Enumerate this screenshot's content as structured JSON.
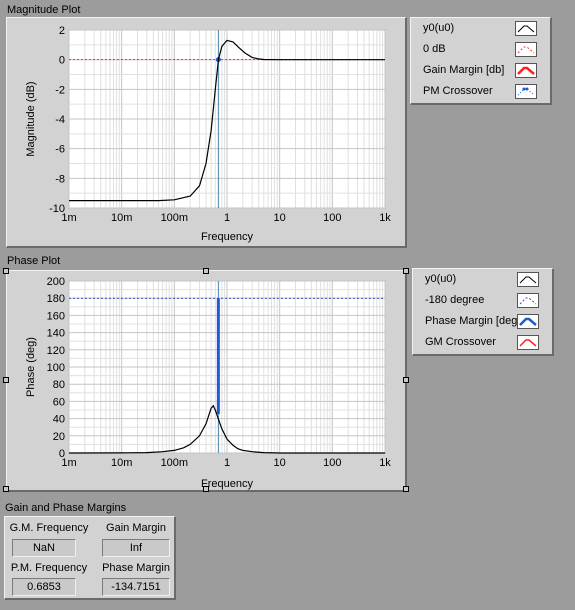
{
  "magnitude": {
    "caption": "Magnitude Plot",
    "ylabel": "Magnitude (dB)",
    "xlabel": "Frequency",
    "legend": [
      "y0(u0)",
      "0 dB",
      "Gain Margin [db]",
      "PM Crossover"
    ],
    "colors": {
      "trace": "#000000",
      "zero_line": "#ff3030",
      "marker": "#1e5ad6",
      "grid": "#c4c4c4",
      "grid_minor": "#e0e0e0"
    }
  },
  "phase": {
    "caption": "Phase Plot",
    "ylabel": "Phase (deg)",
    "xlabel": "Frequency",
    "legend": [
      "y0(u0)",
      "-180 degree",
      "Phase Margin [deg]",
      "GM Crossover"
    ],
    "colors": {
      "trace": "#000000",
      "ref_line": "#3050d0",
      "margin_bar": "#1e5ad6",
      "grid": "#c4c4c4",
      "grid_minor": "#e0e0e0"
    }
  },
  "margins": {
    "title": "Gain and Phase Margins",
    "gm_frequency_label": "G.M. Frequency",
    "gm_frequency_value": "NaN",
    "gain_margin_label": "Gain Margin",
    "gain_margin_value": "Inf",
    "pm_frequency_label": "P.M. Frequency",
    "pm_frequency_value": "0.6853",
    "phase_margin_label": "Phase Margin",
    "phase_margin_value": "-134.7151"
  },
  "chart_data": [
    {
      "type": "line",
      "title": "Magnitude Plot",
      "xlabel": "Frequency",
      "ylabel": "Magnitude (dB)",
      "xscale": "log",
      "xlim": [
        0.001,
        1000
      ],
      "ylim": [
        -10,
        2
      ],
      "xticks": [
        "1m",
        "10m",
        "100m",
        "1",
        "10",
        "100",
        "1k"
      ],
      "yticks": [
        "-10",
        "-8",
        "-6",
        "-4",
        "-2",
        "0",
        "2"
      ],
      "grid": true,
      "legend_position": "right",
      "series": [
        {
          "name": "y0(u0)",
          "x": [
            0.001,
            0.01,
            0.05,
            0.1,
            0.2,
            0.3,
            0.4,
            0.5,
            0.6,
            0.6853,
            0.8,
            1.0,
            1.3,
            1.7,
            2.2,
            3.0,
            4.0,
            5.0,
            10,
            100,
            1000
          ],
          "y": [
            -9.5,
            -9.5,
            -9.5,
            -9.45,
            -9.2,
            -8.5,
            -7.0,
            -4.8,
            -2.0,
            0,
            0.9,
            1.3,
            1.2,
            0.8,
            0.45,
            0.15,
            0.05,
            0.01,
            0,
            0,
            0
          ]
        },
        {
          "name": "0 dB",
          "x": [
            0.001,
            1000
          ],
          "y": [
            0,
            0
          ]
        },
        {
          "name": "PM Crossover",
          "x": [
            0.6853
          ],
          "y": [
            0
          ]
        }
      ]
    },
    {
      "type": "line",
      "title": "Phase Plot",
      "xlabel": "Frequency",
      "ylabel": "Phase (deg)",
      "xscale": "log",
      "xlim": [
        0.001,
        1000
      ],
      "ylim": [
        0,
        200
      ],
      "xticks": [
        "1m",
        "10m",
        "100m",
        "1",
        "10",
        "100",
        "1k"
      ],
      "yticks": [
        "0",
        "20",
        "40",
        "60",
        "80",
        "100",
        "120",
        "140",
        "160",
        "180",
        "200"
      ],
      "grid": true,
      "legend_position": "right",
      "series": [
        {
          "name": "y0(u0)",
          "x": [
            0.001,
            0.01,
            0.03,
            0.06,
            0.1,
            0.15,
            0.2,
            0.3,
            0.4,
            0.5,
            0.55,
            0.6,
            0.7,
            0.8,
            1.0,
            1.3,
            1.6,
            2.0,
            3.0,
            5.0,
            10,
            100,
            1000
          ],
          "y": [
            0,
            0.1,
            0.5,
            1.5,
            3,
            6,
            10,
            20,
            34,
            52,
            55,
            50,
            38,
            28,
            16,
            9,
            5,
            3,
            1.5,
            0.5,
            0,
            0,
            0
          ]
        },
        {
          "name": "-180 degree",
          "x": [
            0.001,
            1000
          ],
          "y": [
            180,
            180
          ]
        },
        {
          "name": "Phase Margin [deg]",
          "x": [
            0.6853,
            0.6853
          ],
          "y": [
            45.3,
            180
          ]
        }
      ]
    }
  ]
}
